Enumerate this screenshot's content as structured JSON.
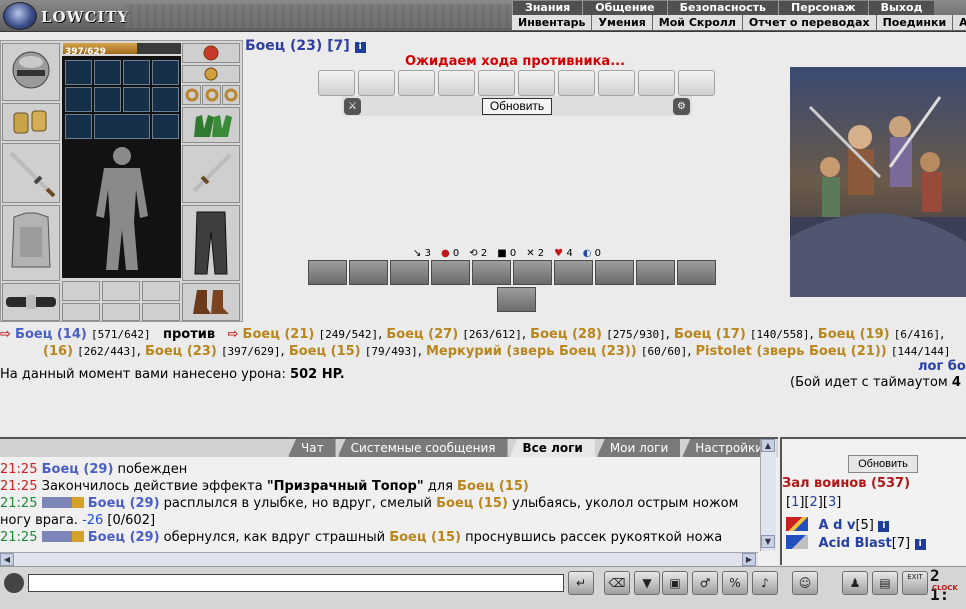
{
  "header": {
    "logo": "LOWCITY",
    "menu_main": [
      "Знания",
      "Общение",
      "Безопасность",
      "Персонаж",
      "Выход"
    ],
    "menu_sub": [
      "Инвентарь",
      "Умения",
      "Мой Скролл",
      "Отчет о переводах",
      "Поединки",
      "Анк"
    ]
  },
  "player": {
    "hp_text": "397/629",
    "hp_fraction": 0.63
  },
  "battle": {
    "fighter_name": "Боец (23)",
    "fighter_level": "[7]",
    "info_icon": "i",
    "waiting_text": "Ожидаем хода противника...",
    "refresh_label": "Обновить",
    "stats": [
      "3",
      "0",
      "2",
      "0",
      "2",
      "4",
      "0"
    ],
    "versus_word": "против",
    "team_a": [
      {
        "name": "Боец (14)",
        "hp": "[571/642]"
      }
    ],
    "team_b": [
      {
        "name": "Боец (21)",
        "hp": "[249/542]"
      },
      {
        "name": "Боец (27)",
        "hp": "[263/612]"
      },
      {
        "name": "Боец (28)",
        "hp": "[275/930]"
      },
      {
        "name": "Боец (17)",
        "hp": "[140/558]"
      },
      {
        "name": "Боец (19)",
        "hp": "[6/416]"
      }
    ],
    "team_b_row2": [
      {
        "name": "(16)",
        "hp": "[262/443]"
      },
      {
        "name": "Боец (23)",
        "hp": "[397/629]"
      },
      {
        "name": "Боец (15)",
        "hp": "[79/493]"
      },
      {
        "name": "Меркурий (зверь Боец (23))",
        "hp": "[60/60]"
      },
      {
        "name": "Pistolet (зверь Боец (21))",
        "hp": "[144/144]"
      }
    ],
    "damage_prefix": "На данный момент вами нанесено урона:",
    "damage_value": "502 HP.",
    "log_link": "лог бо",
    "timeout_prefix": "(Бой идет с таймаутом",
    "timeout_value": "4"
  },
  "chat": {
    "tabs": [
      "Чат",
      "Системные сообщения",
      "Все логи",
      "Мои логи",
      "Настройки"
    ],
    "active_tab": "Все логи",
    "lines": [
      {
        "time": "21:25",
        "a": "Боец (29)",
        "t1": " побежден"
      },
      {
        "time": "21:25",
        "t0": "Закончилось действие эффекта ",
        "q": "\"Призрачный Топор\"",
        "t1": " для ",
        "b": "Боец (15)"
      },
      {
        "time": "21:25",
        "a": "Боец (29)",
        "t1": " расплылся в улыбке, но вдруг, смелый ",
        "b": "Боец (15)",
        "t2": " улыбаясь, уколол острым ножом"
      },
      {
        "cont": "ногу врага. ",
        "dmg": "-26",
        "hp": " [0/602]"
      },
      {
        "time": "21:25",
        "a": "Боец (29)",
        "t1": " обернулся, как вдруг страшный ",
        "b": "Боец (15)",
        "t2": " проснувшись рассек рукояткой ножа"
      }
    ]
  },
  "room": {
    "refresh_label": "Обновить",
    "title": "Зал воинов (537)",
    "pages": [
      "1",
      "2",
      "3"
    ],
    "players": [
      {
        "name": "A d v",
        "level": "[5]"
      },
      {
        "name": "Acid Blast",
        "level": "[7]"
      }
    ]
  },
  "bottom": {
    "input_value": "",
    "clock_text": "2 1:",
    "clock_tag": "CLOCK",
    "exit_label": "EXIT"
  }
}
